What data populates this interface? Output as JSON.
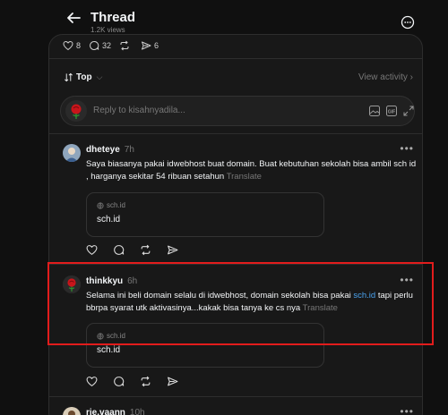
{
  "header": {
    "title": "Thread",
    "views": "1.2K views"
  },
  "stats": {
    "likes": "8",
    "comments": "32",
    "reposts": "",
    "shares": "6"
  },
  "sort": {
    "label": "Top",
    "view_activity": "View activity"
  },
  "reply": {
    "placeholder": "Reply to kisahnyadila..."
  },
  "posts": [
    {
      "username": "dheteye",
      "time": "7h",
      "text": "Saya biasanya pakai idwebhost buat domain. Buat kebutuhan sekolah bisa ambil sch id , harganya sekitar 54 ribuan setahun",
      "translate": "Translate",
      "link_domain": "sch.id",
      "link_title": "sch.id"
    },
    {
      "username": "thinkkyu",
      "time": "6h",
      "text_before": "Selama ini beli domain selalu di idwebhost, domain sekolah bisa pakai ",
      "link_text": "sch.id",
      "text_after": " tapi perlu bbrpa syarat utk aktivasinya...kakak bisa tanya ke cs nya",
      "translate": "Translate",
      "link_domain": "sch.id",
      "link_title": "sch.id"
    },
    {
      "username": "rie.vaann",
      "time": "10h"
    }
  ],
  "colors": {
    "background": "#101010",
    "panel": "#181818",
    "link": "#4aa3f0",
    "highlight": "#e21c1c"
  }
}
